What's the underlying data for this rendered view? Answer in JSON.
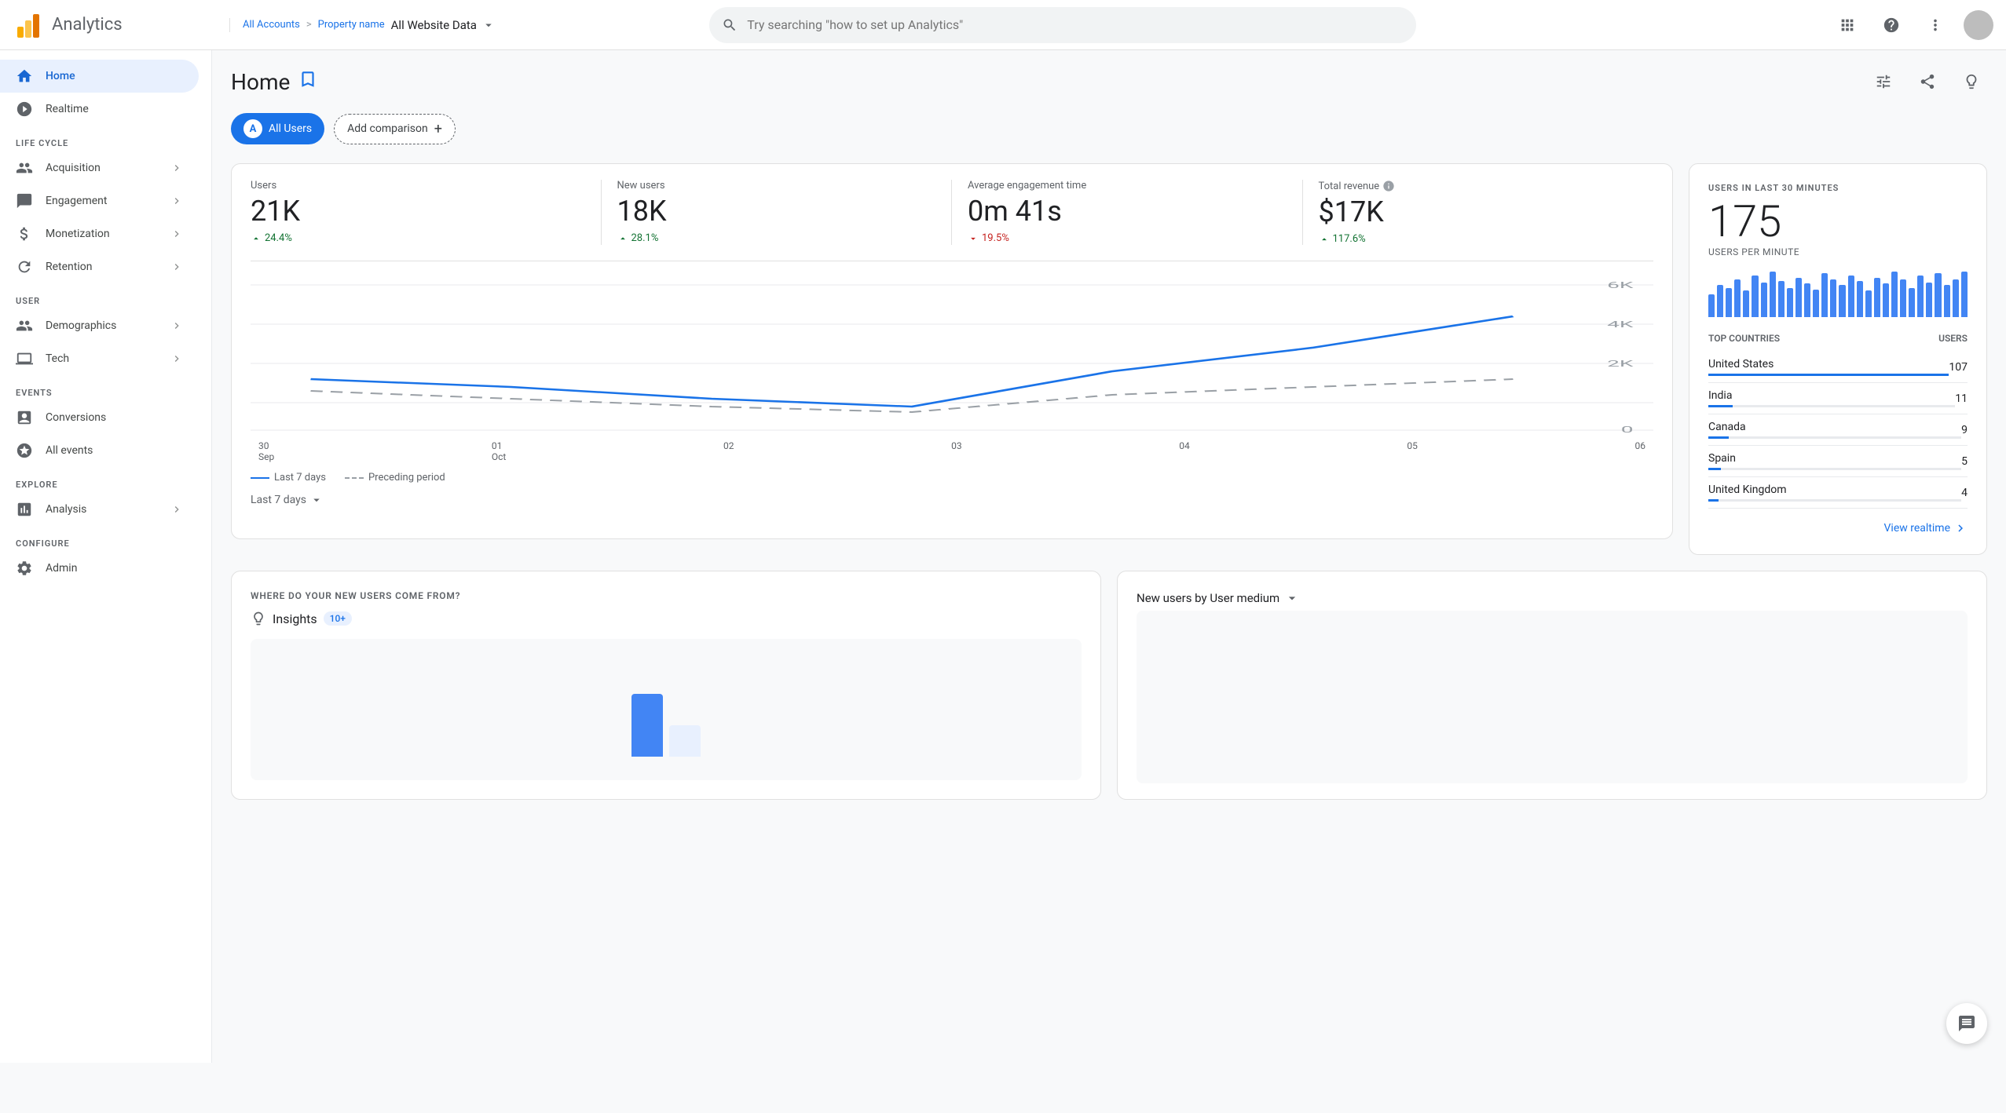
{
  "app": {
    "title": "Analytics",
    "logoAlt": "Google Analytics Logo"
  },
  "header": {
    "breadcrumb": {
      "account": "All Accounts",
      "separator": ">",
      "property": "Property name"
    },
    "propertyLabel": "All Website Data",
    "search": {
      "placeholder": "Try searching \"how to set up Analytics\""
    }
  },
  "sidebar": {
    "navItems": [
      {
        "id": "home",
        "label": "Home",
        "active": true,
        "expandable": false
      },
      {
        "id": "realtime",
        "label": "Realtime",
        "active": false,
        "expandable": false
      }
    ],
    "sections": [
      {
        "label": "LIFE CYCLE",
        "items": [
          {
            "id": "acquisition",
            "label": "Acquisition",
            "expandable": true
          },
          {
            "id": "engagement",
            "label": "Engagement",
            "expandable": true
          },
          {
            "id": "monetization",
            "label": "Monetization",
            "expandable": true
          },
          {
            "id": "retention",
            "label": "Retention",
            "expandable": true
          }
        ]
      },
      {
        "label": "USER",
        "items": [
          {
            "id": "demographics",
            "label": "Demographics",
            "expandable": true
          },
          {
            "id": "tech",
            "label": "Tech",
            "expandable": true
          }
        ]
      },
      {
        "label": "EVENTS",
        "items": [
          {
            "id": "conversions",
            "label": "Conversions",
            "expandable": false
          },
          {
            "id": "allevents",
            "label": "All events",
            "expandable": false
          }
        ]
      },
      {
        "label": "EXPLORE",
        "items": [
          {
            "id": "analysis",
            "label": "Analysis",
            "expandable": true
          }
        ]
      },
      {
        "label": "CONFIGURE",
        "items": [
          {
            "id": "admin",
            "label": "Admin",
            "expandable": false
          }
        ]
      }
    ]
  },
  "page": {
    "title": "Home",
    "filter": {
      "allUsers": "All Users",
      "addComparison": "Add comparison"
    },
    "stats": {
      "users": {
        "label": "Users",
        "value": "21K",
        "change": "24.4%",
        "changeDir": "up"
      },
      "newUsers": {
        "label": "New users",
        "value": "18K",
        "change": "28.1%",
        "changeDir": "up"
      },
      "avgEngagement": {
        "label": "Average engagement time",
        "value": "0m 41s",
        "change": "19.5%",
        "changeDir": "down"
      },
      "totalRevenue": {
        "label": "Total revenue",
        "value": "$17K",
        "change": "117.6%",
        "changeDir": "up"
      }
    },
    "chart": {
      "xLabels": [
        "30 Sep",
        "01 Oct",
        "02",
        "03",
        "04",
        "05",
        "06"
      ],
      "yLabels": [
        "6K",
        "4K",
        "2K",
        "0"
      ],
      "legend": {
        "lastPeriod": "Last 7 days",
        "preceding": "Preceding period"
      },
      "timeSelector": "Last 7 days"
    },
    "realtime": {
      "title": "USERS IN LAST 30 MINUTES",
      "count": "175",
      "subtitle": "USERS PER MINUTE",
      "topCountriesLabel": "TOP COUNTRIES",
      "usersLabel": "USERS",
      "countries": [
        {
          "name": "United States",
          "count": 107,
          "barPct": 100
        },
        {
          "name": "India",
          "count": 11,
          "barPct": 10
        },
        {
          "name": "Canada",
          "count": 9,
          "barPct": 8
        },
        {
          "name": "Spain",
          "count": 5,
          "barPct": 5
        },
        {
          "name": "United Kingdom",
          "count": 4,
          "barPct": 4
        }
      ],
      "viewRealtimeLink": "View realtime"
    },
    "bottomSection": {
      "whereLabel": "WHERE DO YOUR NEW USERS COME FROM?",
      "insights": {
        "title": "Insights",
        "badgeCount": "10+"
      },
      "newUsersByMedium": {
        "title": "New users by User medium"
      }
    }
  },
  "miniBarHeights": [
    30,
    42,
    38,
    50,
    35,
    55,
    45,
    60,
    48,
    38,
    52,
    44,
    36,
    58,
    50,
    42,
    55,
    48,
    35,
    52,
    44,
    60,
    50,
    38,
    55,
    45,
    58,
    42,
    50,
    60
  ]
}
